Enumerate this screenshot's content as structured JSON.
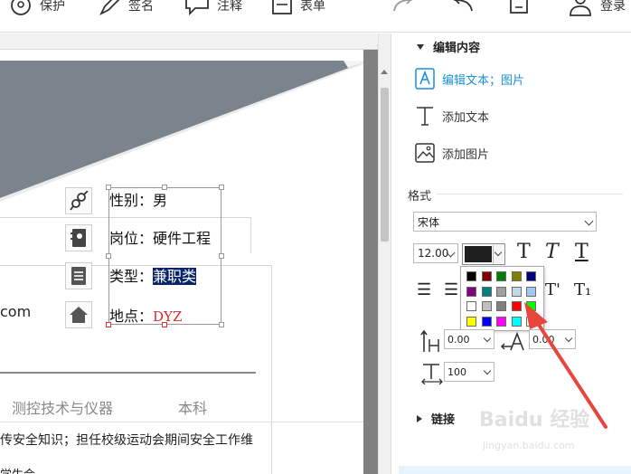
{
  "toolbar": {
    "protect_label": "保护",
    "sign_label": "签名",
    "comment_label": "注释",
    "form_label": "表单",
    "login_label": "登录"
  },
  "doc": {
    "gender": "性别：男",
    "position": "岗位：硬件工程",
    "type_prefix": "类型：",
    "type_value": "兼职类",
    "location_prefix": "地点：",
    "location_value": "DYZ",
    "email_fragment": "com",
    "major": "测控技术与仪器",
    "degree": "本科",
    "duty_text": "传安全知识；担任校级运动会期间安全工作维",
    "bottom_fragment": "学生会"
  },
  "panel": {
    "edit_section": "编辑内容",
    "edit_text_image": "编辑文本；图片",
    "add_text": "添加文本",
    "add_image": "添加图片",
    "format_label": "格式",
    "font_name": "宋体",
    "font_size": "12.00",
    "char_spacing": "0.00",
    "line_spacing": "0.00",
    "scale": "100",
    "link_section": "链接"
  },
  "colors": {
    "accent": "#1890d8",
    "current_font_color": "#1e1e1e",
    "palette": [
      "#000000",
      "#800000",
      "#008000",
      "#808000",
      "#000080",
      "#800080",
      "#008080",
      "#a0a0a0",
      "#c0d8e8",
      "#a0c8f0",
      "#ffffff",
      "#c0c0c0",
      "#808080",
      "#ff0000",
      "#00ff00",
      "#ffff00",
      "#0000ff",
      "#ff00ff",
      "#00ffff",
      "#ffffff"
    ]
  },
  "watermark": {
    "brand": "Baidu 经验",
    "url": "jingyan.baidu.com"
  }
}
